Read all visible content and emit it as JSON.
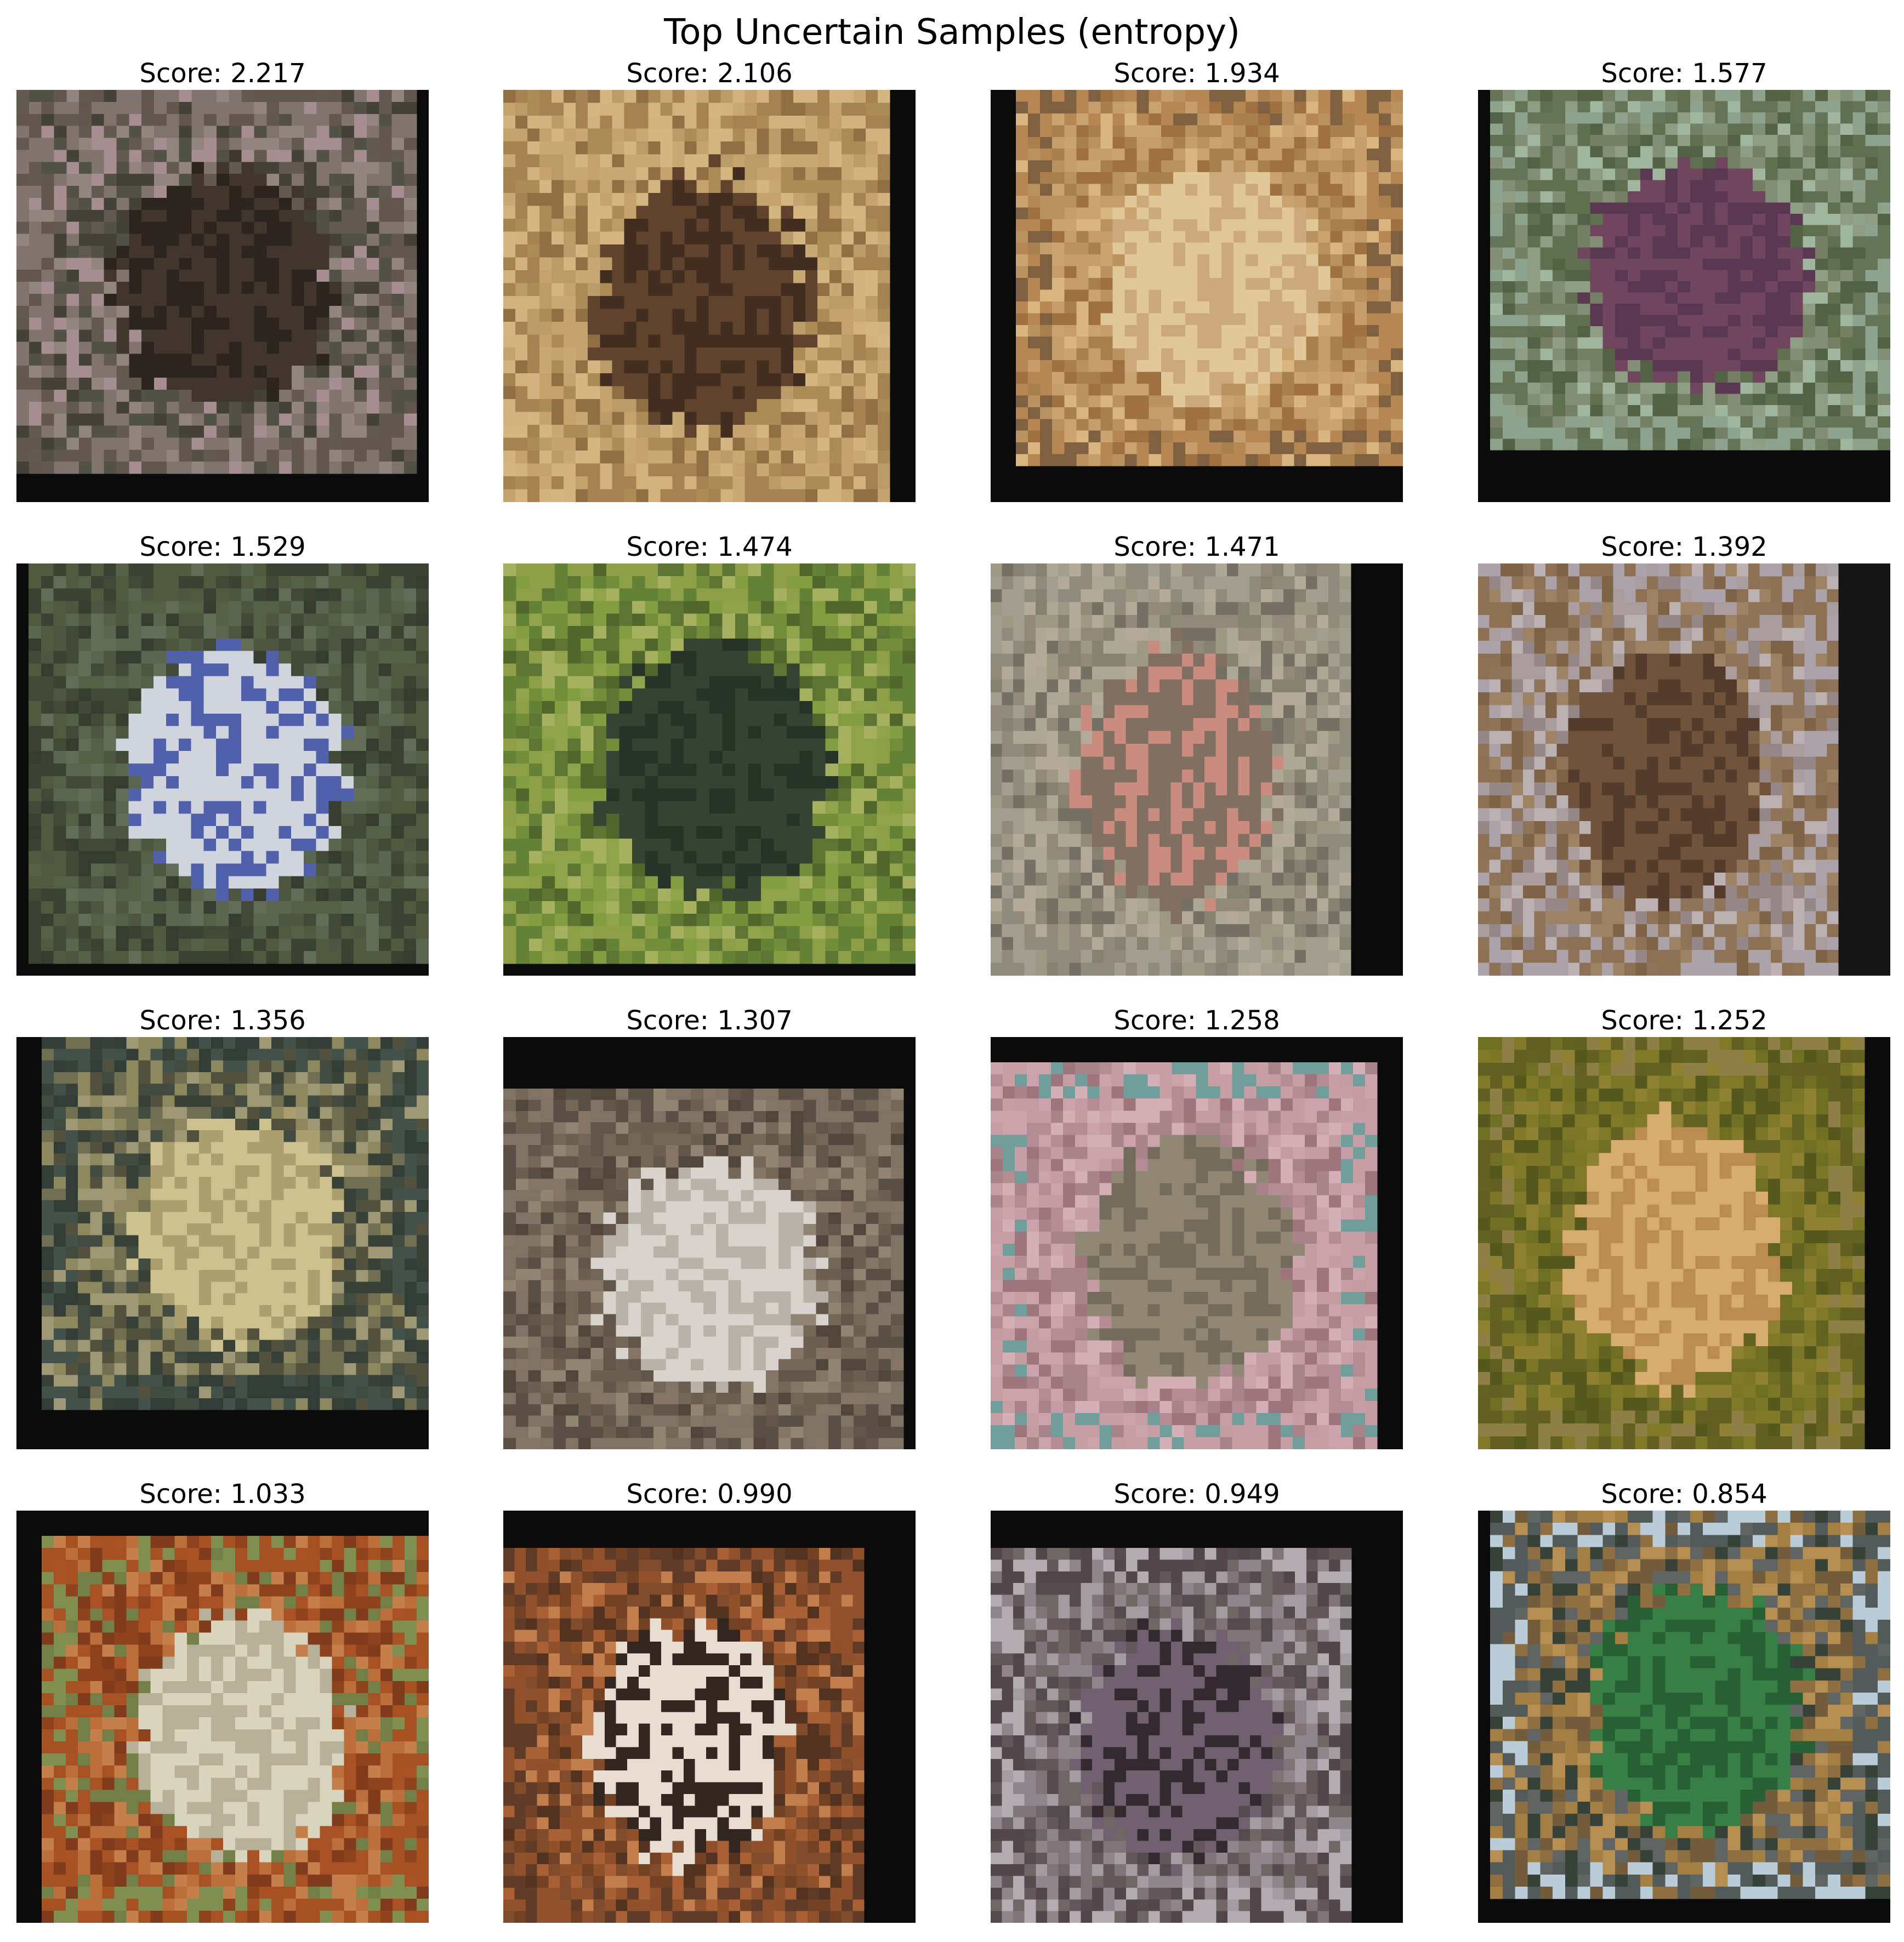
{
  "figure": {
    "title": "Top Uncertain Samples (entropy)"
  },
  "panels": [
    {
      "score_label": "Score: 2.217",
      "bg": "#0b0b0b",
      "palette": [
        "#7c6e68",
        "#4a4a3e",
        "#8e7f7a",
        "#5d5448",
        "#a3898e",
        "#3c3a30"
      ],
      "border": [
        "#7c6e68",
        "#5b5145"
      ],
      "subject": [
        "#3a2e24",
        "#241c16"
      ]
    },
    {
      "score_label": "Score: 2.106",
      "bg": "#0b0b0b",
      "palette": [
        "#c6a66f",
        "#b89863",
        "#d3b37c",
        "#a8884f",
        "#c2a066",
        "#8c6a3e"
      ],
      "border": [
        "#d1b07a",
        "#a27d4a"
      ],
      "subject": [
        "#5a3b25",
        "#3a2617"
      ]
    },
    {
      "score_label": "Score: 1.934",
      "bg": "#0b0b0b",
      "palette": [
        "#c9a06a",
        "#b88e5a",
        "#d8b27b",
        "#a67a45",
        "#c49a65",
        "#9c6c3a"
      ],
      "border": [
        "#b3834d",
        "#7a5a3a"
      ],
      "subject": [
        "#e0c596",
        "#c9a677"
      ]
    },
    {
      "score_label": "Score: 1.577",
      "bg": "#0b0b0b",
      "palette": [
        "#6f7a5e",
        "#5a6a48",
        "#8b9a80",
        "#9db39b",
        "#4d5c3d",
        "#7d8a70"
      ],
      "border": [
        "#8aa08a",
        "#5f6e50"
      ],
      "subject": [
        "#6b3e58",
        "#55304a"
      ]
    },
    {
      "score_label": "Score: 1.529",
      "bg": "#0b0b0b",
      "palette": [
        "#47503a",
        "#3b432f",
        "#55604a",
        "#2e3526",
        "#4f5a40",
        "#5d6650"
      ],
      "border": [
        "#4a5338",
        "#343b2a"
      ],
      "subject": [
        "#cfd4dc",
        "#4a5aa8"
      ]
    },
    {
      "score_label": "Score: 1.474",
      "bg": "#0b0b0b",
      "palette": [
        "#6d8a32",
        "#56702a",
        "#8ca043",
        "#a3ae5a",
        "#4a6022",
        "#7e9a3a"
      ],
      "border": [
        "#5e7d2e",
        "#8a9c40"
      ],
      "subject": [
        "#2d3c2a",
        "#1f2b1e"
      ]
    },
    {
      "score_label": "Score: 1.471",
      "bg": "#0b0b0b",
      "palette": [
        "#9a9580",
        "#827d6c",
        "#aaa591",
        "#6f6c5e",
        "#b0a796",
        "#8d8676"
      ],
      "border": [
        "#8c8878",
        "#a09c8c"
      ],
      "subject": [
        "#7c6a5c",
        "#c8887a"
      ]
    },
    {
      "score_label": "Score: 1.392",
      "bg": "#151515",
      "palette": [
        "#a69a9c",
        "#918383",
        "#8c6f54",
        "#7a5d40",
        "#b9aeb0",
        "#9b7d5e"
      ],
      "border": [
        "#a8a0a6",
        "#8a6c4e"
      ],
      "subject": [
        "#6c4c34",
        "#4d3523"
      ]
    },
    {
      "score_label": "Score: 1.356",
      "bg": "#0b0b0b",
      "palette": [
        "#4a4a36",
        "#2f3a30",
        "#8a8458",
        "#9c9470",
        "#3a4438",
        "#6b6a4a"
      ],
      "border": [
        "#3c4a44",
        "#2a3630"
      ],
      "subject": [
        "#cdbf8c",
        "#a99c6a"
      ]
    },
    {
      "score_label": "Score: 1.307",
      "bg": "#0b0b0b",
      "palette": [
        "#6f6152",
        "#5c4f42",
        "#807060",
        "#4a3f35",
        "#8d7f6e",
        "#66584a"
      ],
      "border": [
        "#7a6e60",
        "#54483d"
      ],
      "subject": [
        "#d8d2cb",
        "#b7afa6"
      ]
    },
    {
      "score_label": "Score: 1.258",
      "bg": "#0b0b0b",
      "palette": [
        "#c29aa0",
        "#b38890",
        "#d3adb3",
        "#a57f86",
        "#c8a1a7",
        "#9c7077"
      ],
      "border": [
        "#6c9a96",
        "#c49ba1"
      ],
      "subject": [
        "#8c8470",
        "#6e6656"
      ]
    },
    {
      "score_label": "Score: 1.252",
      "bg": "#0b0b0b",
      "palette": [
        "#6a6a1c",
        "#7a7420",
        "#5c5c18",
        "#8a7d2a",
        "#4f5214",
        "#76721e"
      ],
      "border": [
        "#8a7a40",
        "#5b5a1a"
      ],
      "subject": [
        "#d6a96a",
        "#b9884a"
      ]
    },
    {
      "score_label": "Score: 1.033",
      "bg": "#0b0b0b",
      "palette": [
        "#a44a1c",
        "#8a3c14",
        "#bb6a34",
        "#6e7a40",
        "#c27a44",
        "#7a3412"
      ],
      "border": [
        "#a24a1a",
        "#7b8a48"
      ],
      "subject": [
        "#d8d3bc",
        "#b4ae94"
      ]
    },
    {
      "score_label": "Score: 0.990",
      "bg": "#0b0b0b",
      "palette": [
        "#8c4a22",
        "#a65a2c",
        "#6e3a1c",
        "#c07a46",
        "#7c4524",
        "#4c2a16"
      ],
      "border": [
        "#8d4a24",
        "#5a3420"
      ],
      "subject": [
        "#e8dcd0",
        "#2a1e18"
      ]
    },
    {
      "score_label": "Score: 0.949",
      "bg": "#0b0b0b",
      "palette": [
        "#6a6060",
        "#8a8286",
        "#4e4448",
        "#a09a9e",
        "#5c5254",
        "#7a7074"
      ],
      "border": [
        "#4a4044",
        "#b0a9ae"
      ],
      "subject": [
        "#6c5a6a",
        "#2a2226"
      ]
    },
    {
      "score_label": "Score: 0.854",
      "bg": "#0b0b0b",
      "palette": [
        "#8a6a3a",
        "#a07a3c",
        "#6e5634",
        "#b48a4a",
        "#2e3a30",
        "#5a5e5c"
      ],
      "border": [
        "#b8cad6",
        "#4d5454"
      ],
      "subject": [
        "#2f7a3e",
        "#1f5a2c"
      ]
    }
  ]
}
